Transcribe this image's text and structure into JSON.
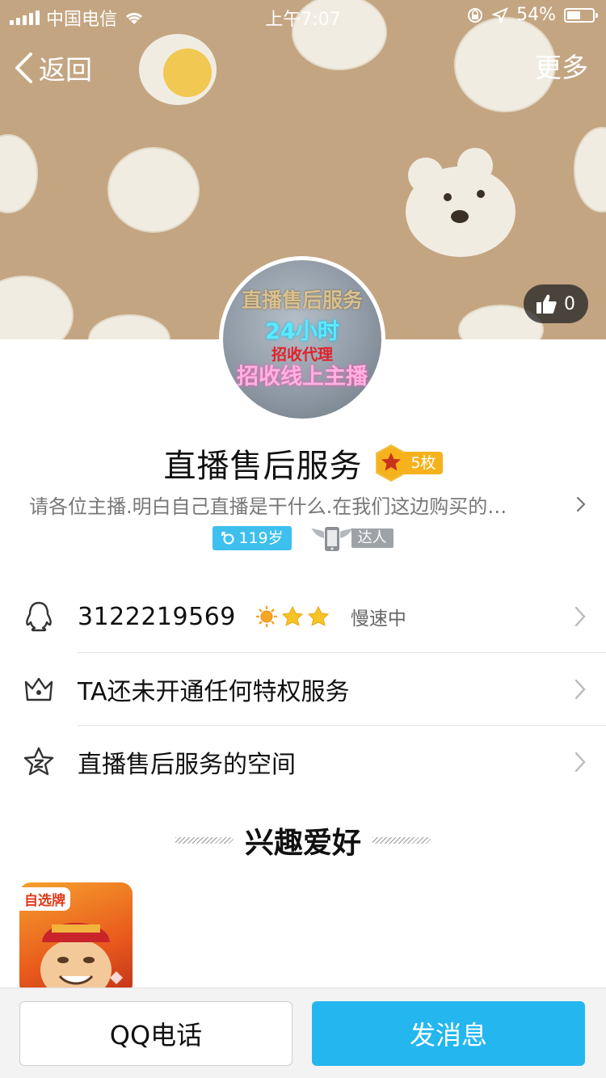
{
  "status_bar": {
    "carrier": "中国电信",
    "time": "上午7:07",
    "battery_percent": "54%",
    "battery_level": 0.54
  },
  "nav": {
    "back_label": "返回",
    "more_label": "更多"
  },
  "like": {
    "count": "0"
  },
  "avatar_text": {
    "line1": "直播售后服务",
    "line2": "24小时",
    "line3": "招收代理",
    "line4": "招收线上主播"
  },
  "profile": {
    "name": "直播售后服务",
    "medal_count": "5枚",
    "signature": "请各位主播.明白自己直播是干什么.在我们这边购买的…",
    "age": "119岁",
    "talent_label": "达人"
  },
  "list": {
    "qq_number": "3122219569",
    "qq_status": "慢速中",
    "privilege": "TA还未开通任何特权服务",
    "space": "直播售后服务的空间"
  },
  "interests": {
    "title": "兴趣爱好",
    "game_badge": "自选牌"
  },
  "bottom": {
    "call_label": "QQ电话",
    "message_label": "发消息"
  }
}
